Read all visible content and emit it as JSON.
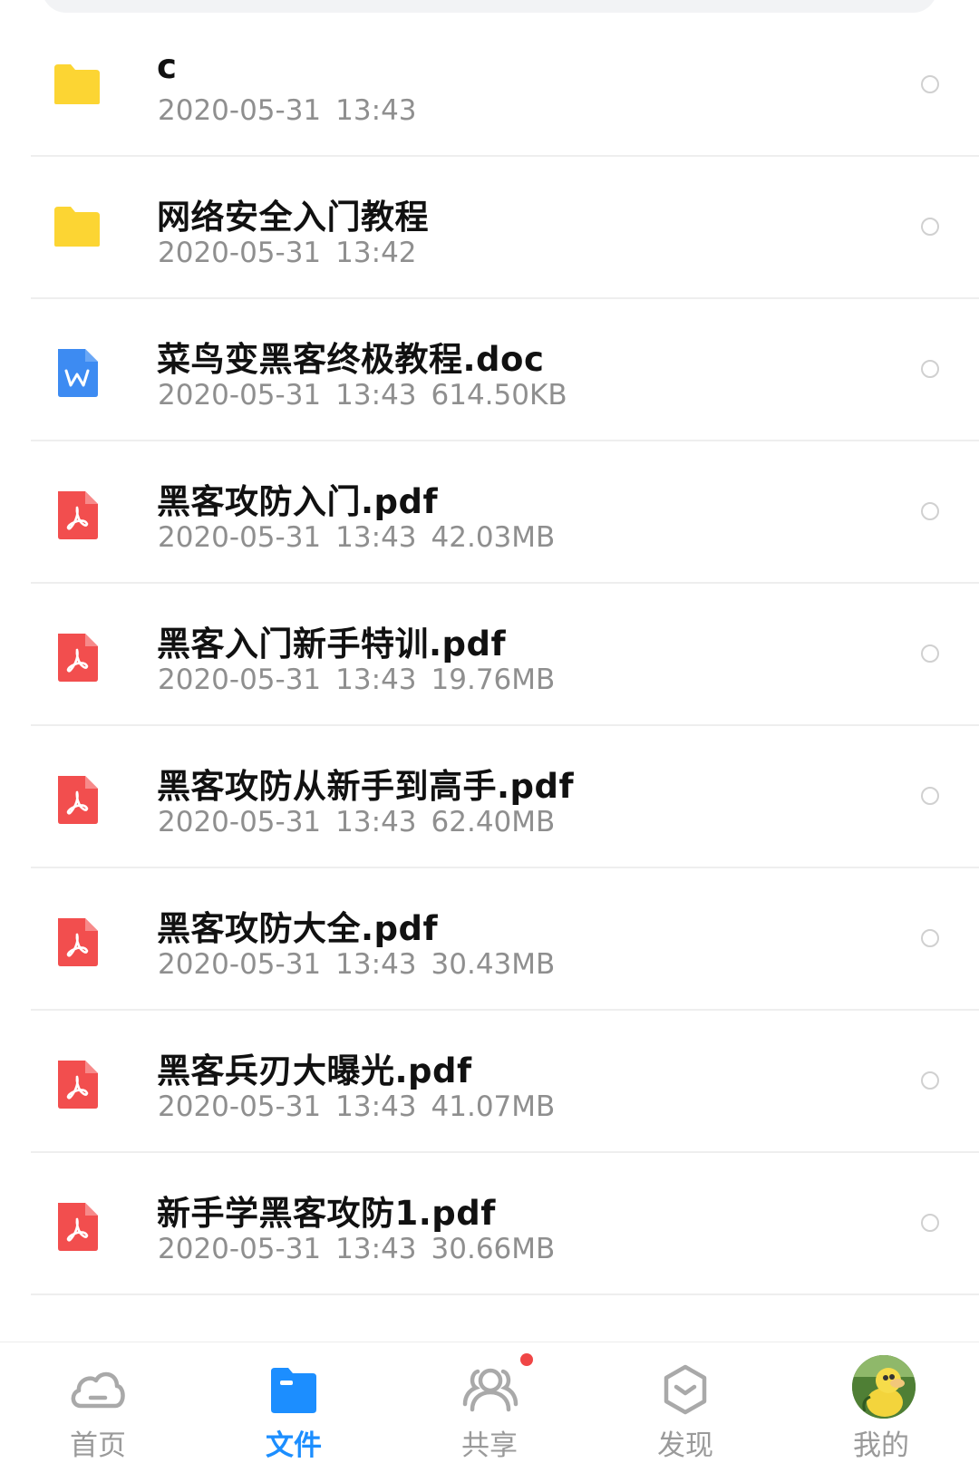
{
  "files": [
    {
      "type": "folder",
      "name": "c",
      "date": "2020-05-31",
      "time": "13:43",
      "size": ""
    },
    {
      "type": "folder",
      "name": "网络安全入门教程",
      "date": "2020-05-31",
      "time": "13:42",
      "size": ""
    },
    {
      "type": "doc",
      "name": "菜鸟变黑客终极教程.doc",
      "date": "2020-05-31",
      "time": "13:43",
      "size": "614.50KB"
    },
    {
      "type": "pdf",
      "name": "黑客攻防入门.pdf",
      "date": "2020-05-31",
      "time": "13:43",
      "size": "42.03MB"
    },
    {
      "type": "pdf",
      "name": "黑客入门新手特训.pdf",
      "date": "2020-05-31",
      "time": "13:43",
      "size": "19.76MB"
    },
    {
      "type": "pdf",
      "name": "黑客攻防从新手到高手.pdf",
      "date": "2020-05-31",
      "time": "13:43",
      "size": "62.40MB"
    },
    {
      "type": "pdf",
      "name": "黑客攻防大全.pdf",
      "date": "2020-05-31",
      "time": "13:43",
      "size": "30.43MB"
    },
    {
      "type": "pdf",
      "name": "黑客兵刃大曝光.pdf",
      "date": "2020-05-31",
      "time": "13:43",
      "size": "41.07MB"
    },
    {
      "type": "pdf",
      "name": "新手学黑客攻防1.pdf",
      "date": "2020-05-31",
      "time": "13:43",
      "size": "30.66MB"
    }
  ],
  "icons": {
    "folder": "folder-icon",
    "doc": "word-doc-icon",
    "pdf": "pdf-icon"
  },
  "nav": {
    "items": [
      {
        "label": "首页",
        "icon": "cloud-home-icon",
        "active": false
      },
      {
        "label": "文件",
        "icon": "folder-files-icon",
        "active": true
      },
      {
        "label": "共享",
        "icon": "users-share-icon",
        "active": false,
        "badge": true
      },
      {
        "label": "发现",
        "icon": "discover-box-icon",
        "active": false
      },
      {
        "label": "我的",
        "icon": "avatar-profile-icon",
        "active": false
      }
    ]
  },
  "colors": {
    "folder": "#fcd533",
    "doc": "#3d8bf2",
    "pdf": "#f24e4e",
    "accent": "#1c8eff",
    "badge": "#f04646",
    "meta_text": "#8f8f8f"
  }
}
